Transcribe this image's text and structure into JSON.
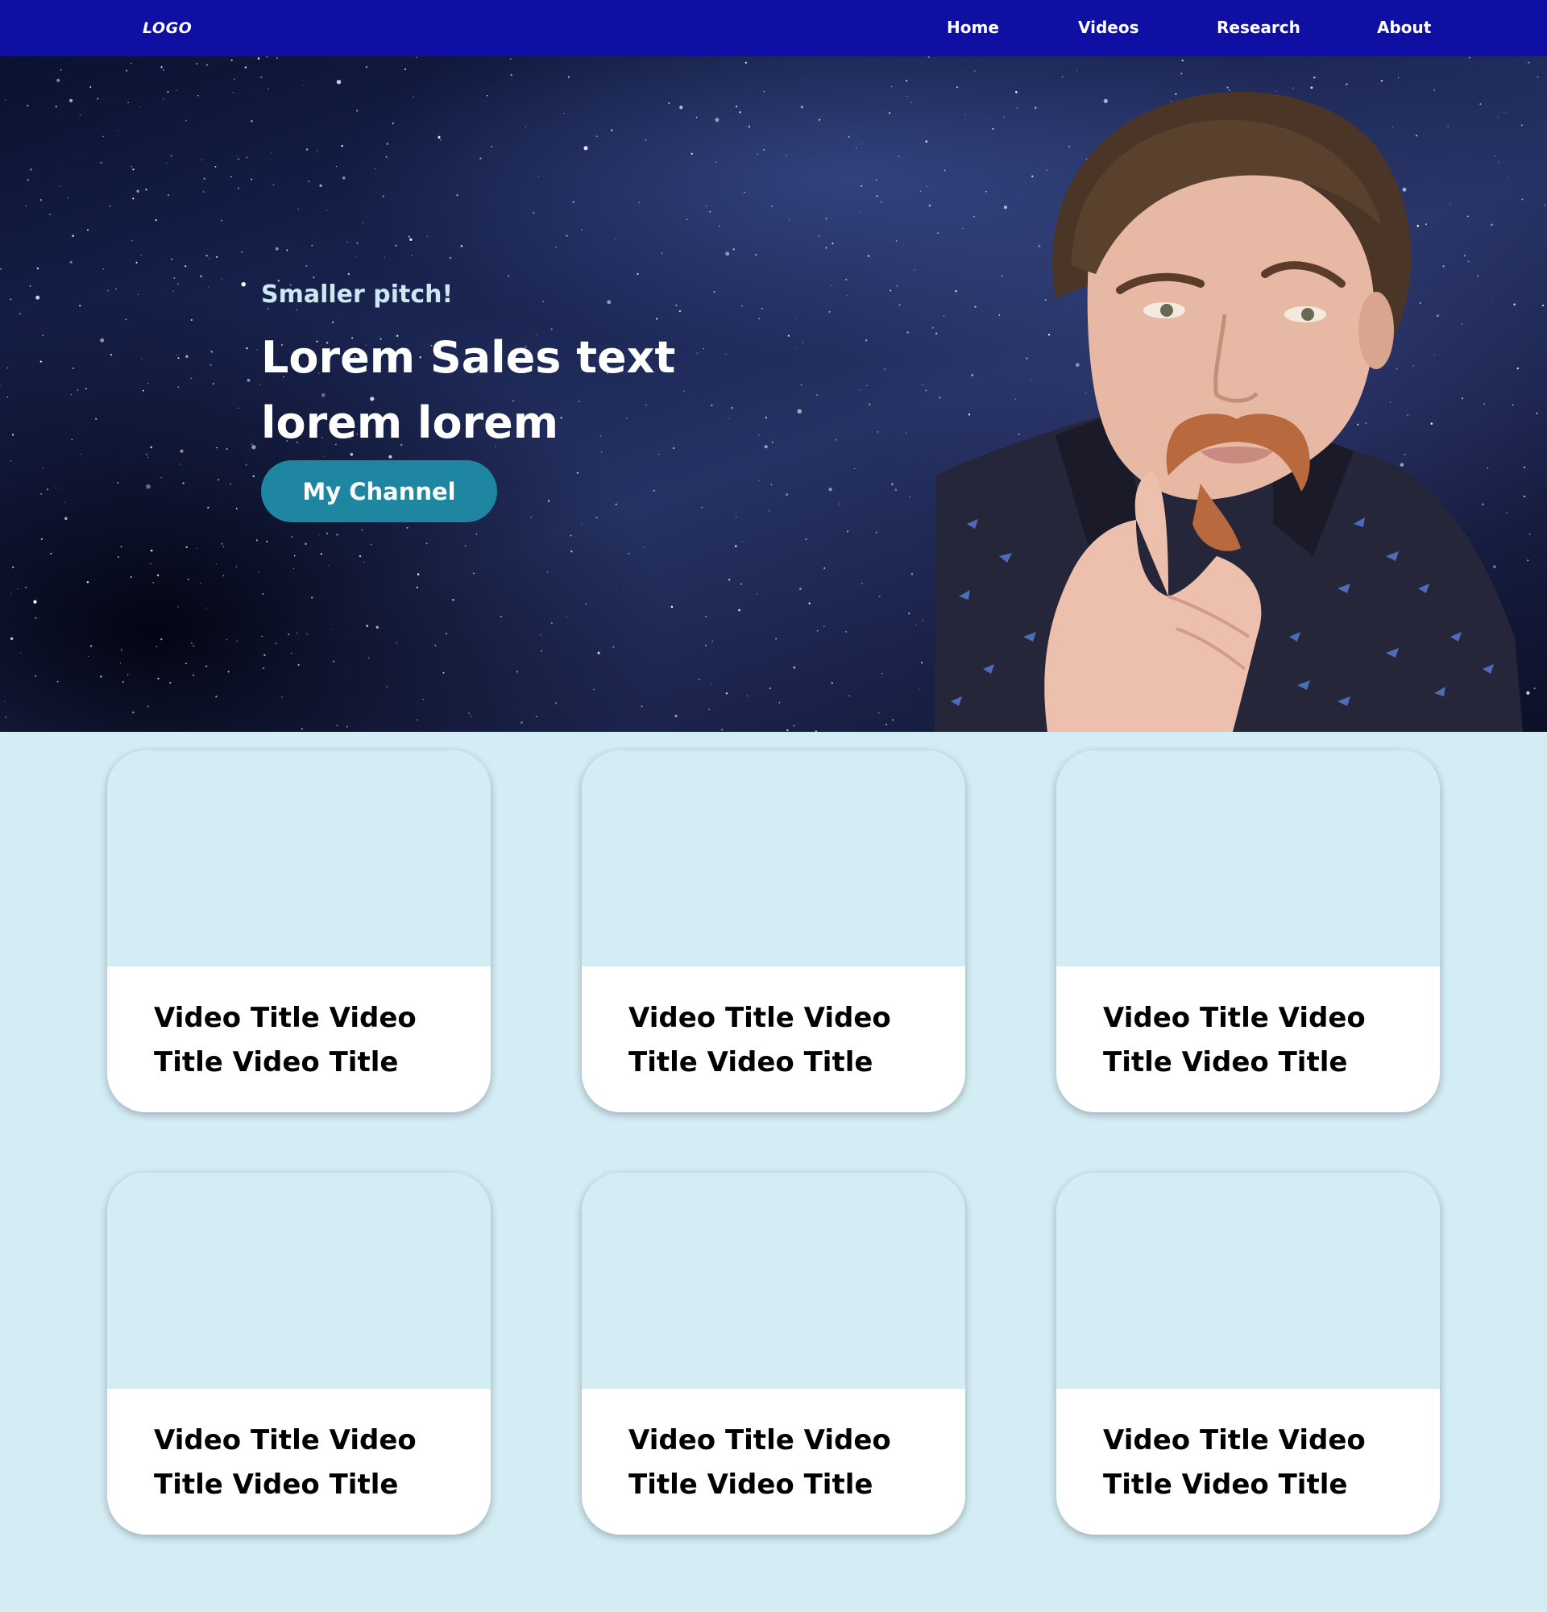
{
  "nav": {
    "logo": "LOGO",
    "links": [
      {
        "label": "Home"
      },
      {
        "label": "Videos"
      },
      {
        "label": "Research"
      },
      {
        "label": "About"
      }
    ]
  },
  "hero": {
    "subtitle": "Smaller pitch!",
    "title": "Lorem Sales text lorem lorem",
    "cta_label": "My Channel"
  },
  "videos": [
    {
      "title": "Video Title Video Title Video Title"
    },
    {
      "title": "Video Title Video Title Video Title"
    },
    {
      "title": "Video Title Video Title Video Title"
    },
    {
      "title": "Video Title Video Title Video Title"
    },
    {
      "title": "Video Title Video Title Video Title"
    },
    {
      "title": "Video Title Video Title Video Title"
    }
  ],
  "colors": {
    "nav_bg": "#0f0fa3",
    "button": "#1f86a1",
    "page_bg": "#d4ecf4",
    "card_bg": "#ffffff"
  }
}
